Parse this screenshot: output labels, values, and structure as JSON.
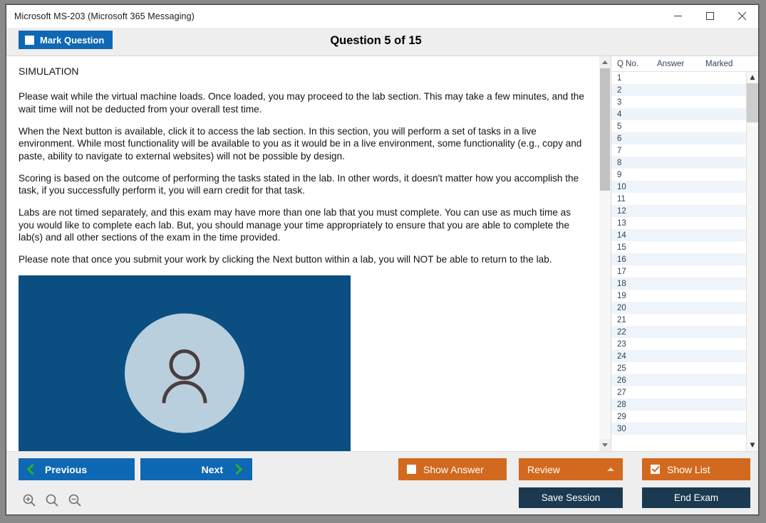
{
  "window": {
    "title": "Microsoft MS-203 (Microsoft 365 Messaging)",
    "minimize_label": "Minimize",
    "maximize_label": "Maximize",
    "close_label": "Close"
  },
  "header": {
    "mark_question_label": "Mark Question",
    "mark_question_checked": false,
    "question_title": "Question 5 of 15"
  },
  "content": {
    "heading": "SIMULATION",
    "paragraphs": [
      "Please wait while the virtual machine loads. Once loaded, you may proceed to the lab section. This may take a few minutes, and the wait time will not be deducted from your overall test time.",
      "When the Next button is available, click it to access the lab section. In this section, you will perform a set of tasks in a live environment. While most functionality will be available to you as it would be in a live environment, some functionality (e.g., copy and paste, ability to navigate to external websites) will not be possible by design.",
      "Scoring is based on the outcome of performing the tasks stated in the lab. In other words, it doesn't matter how you accomplish the task, if you successfully perform it, you will earn credit for that task.",
      "Labs are not timed separately, and this exam may have more than one lab that you must complete. You can use as much time as you would like to complete each lab. But, you should manage your time appropriately to ensure that you are able to complete the lab(s) and all other sections of the exam in the time provided.",
      "Please note that once you submit your work by clicking the Next button within a lab, you will NOT be able to return to the lab."
    ],
    "image_alt": "windows-login-avatar"
  },
  "question_list": {
    "columns": [
      "Q No.",
      "Answer",
      "Marked"
    ],
    "rows": [
      {
        "no": "1",
        "answer": "",
        "marked": ""
      },
      {
        "no": "2",
        "answer": "",
        "marked": ""
      },
      {
        "no": "3",
        "answer": "",
        "marked": ""
      },
      {
        "no": "4",
        "answer": "",
        "marked": ""
      },
      {
        "no": "5",
        "answer": "",
        "marked": ""
      },
      {
        "no": "6",
        "answer": "",
        "marked": ""
      },
      {
        "no": "7",
        "answer": "",
        "marked": ""
      },
      {
        "no": "8",
        "answer": "",
        "marked": ""
      },
      {
        "no": "9",
        "answer": "",
        "marked": ""
      },
      {
        "no": "10",
        "answer": "",
        "marked": ""
      },
      {
        "no": "11",
        "answer": "",
        "marked": ""
      },
      {
        "no": "12",
        "answer": "",
        "marked": ""
      },
      {
        "no": "13",
        "answer": "",
        "marked": ""
      },
      {
        "no": "14",
        "answer": "",
        "marked": ""
      },
      {
        "no": "15",
        "answer": "",
        "marked": ""
      },
      {
        "no": "16",
        "answer": "",
        "marked": ""
      },
      {
        "no": "17",
        "answer": "",
        "marked": ""
      },
      {
        "no": "18",
        "answer": "",
        "marked": ""
      },
      {
        "no": "19",
        "answer": "",
        "marked": ""
      },
      {
        "no": "20",
        "answer": "",
        "marked": ""
      },
      {
        "no": "21",
        "answer": "",
        "marked": ""
      },
      {
        "no": "22",
        "answer": "",
        "marked": ""
      },
      {
        "no": "23",
        "answer": "",
        "marked": ""
      },
      {
        "no": "24",
        "answer": "",
        "marked": ""
      },
      {
        "no": "25",
        "answer": "",
        "marked": ""
      },
      {
        "no": "26",
        "answer": "",
        "marked": ""
      },
      {
        "no": "27",
        "answer": "",
        "marked": ""
      },
      {
        "no": "28",
        "answer": "",
        "marked": ""
      },
      {
        "no": "29",
        "answer": "",
        "marked": ""
      },
      {
        "no": "30",
        "answer": "",
        "marked": ""
      }
    ]
  },
  "footer": {
    "previous_label": "Previous",
    "next_label": "Next",
    "show_answer_label": "Show Answer",
    "show_answer_checked": false,
    "review_label": "Review",
    "show_list_label": "Show List",
    "show_list_checked": true,
    "save_session_label": "Save Session",
    "end_exam_label": "End Exam",
    "zoom_in_label": "Zoom In",
    "zoom_reset_label": "Zoom",
    "zoom_out_label": "Zoom Out"
  },
  "colors": {
    "accent_blue": "#0f68b4",
    "accent_orange": "#d2691e",
    "accent_navy": "#1b3a52",
    "chevron_green": "#2ab02a",
    "image_background": "#0b4f82"
  }
}
